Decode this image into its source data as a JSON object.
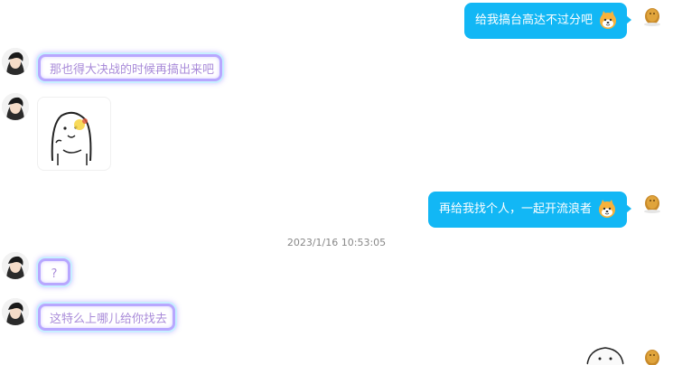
{
  "messages": [
    {
      "side": "right",
      "text": "给我搞台高达不过分吧"
    },
    {
      "side": "left",
      "text": "那也得大决战的时候再搞出来吧"
    },
    {
      "side": "left",
      "type": "sticker"
    },
    {
      "side": "right",
      "text": "再给我找个人，一起开流浪者"
    },
    {
      "side": "left",
      "text": "?"
    },
    {
      "side": "left",
      "text": "这特么上哪儿给你找去"
    },
    {
      "side": "right",
      "type": "sticker"
    }
  ],
  "timestamp": "2023/1/16 10:53:05",
  "colors": {
    "outgoing_bubble": "#12b7f5",
    "incoming_text": "#a98bd9",
    "incoming_border": "#b8a7ff"
  },
  "icons": {
    "emoji": "shiba-dog-emoji-icon",
    "sticker": "cat-face-sticker-icon"
  }
}
